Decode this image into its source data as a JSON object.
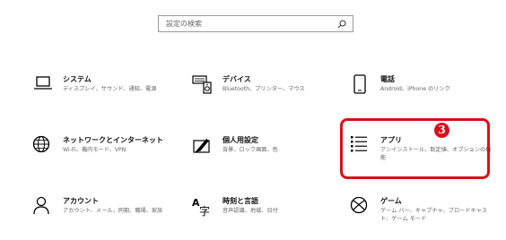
{
  "search": {
    "placeholder": "設定の検索"
  },
  "tiles": [
    {
      "title": "システム",
      "desc": "ディスプレイ、サウンド、通知、電源",
      "icon": "laptop-icon"
    },
    {
      "title": "デバイス",
      "desc": "Bluetooth、プリンター、マウス",
      "icon": "keyboard-speaker-icon"
    },
    {
      "title": "電話",
      "desc": "Android、iPhone のリンク",
      "icon": "phone-icon"
    },
    {
      "title": "ネットワークとインターネット",
      "desc": "Wi-Fi、機内モード、VPN",
      "icon": "globe-icon"
    },
    {
      "title": "個人用設定",
      "desc": "背景、ロック画面、色",
      "icon": "paint-brush-icon"
    },
    {
      "title": "アプリ",
      "desc": "アンインストール、既定値、オプションの機能",
      "icon": "app-list-icon"
    },
    {
      "title": "アカウント",
      "desc": "アカウント、メール、同期、職場、家族",
      "icon": "person-icon"
    },
    {
      "title": "時刻と言語",
      "desc": "音声認識、地域、日付",
      "icon": "language-time-icon"
    },
    {
      "title": "ゲーム",
      "desc": "ゲーム バー、キャプチャ、ブロードキャスト、ゲーム モード",
      "icon": "xbox-icon"
    }
  ],
  "annotation": {
    "badge": "3",
    "color": "#d8101a"
  }
}
